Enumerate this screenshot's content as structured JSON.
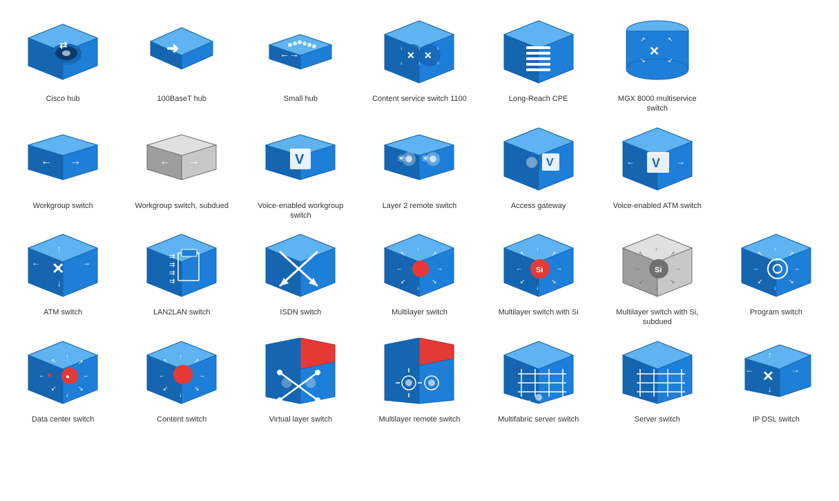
{
  "items": [
    {
      "id": "cisco-hub",
      "label": "Cisco hub",
      "type": "cisco-hub"
    },
    {
      "id": "100baset-hub",
      "label": "100BaseT hub",
      "type": "100baset-hub"
    },
    {
      "id": "small-hub",
      "label": "Small hub",
      "type": "small-hub"
    },
    {
      "id": "content-service-switch",
      "label": "Content service switch 1100",
      "type": "content-service-switch"
    },
    {
      "id": "long-reach-cpe",
      "label": "Long-Reach CPE",
      "type": "long-reach-cpe"
    },
    {
      "id": "mgx-8000",
      "label": "MGX 8000 multiservice switch",
      "type": "mgx-8000"
    },
    {
      "id": "empty1",
      "label": "",
      "type": "empty"
    },
    {
      "id": "workgroup-switch",
      "label": "Workgroup switch",
      "type": "workgroup-switch"
    },
    {
      "id": "workgroup-switch-subdued",
      "label": "Workgroup switch, subdued",
      "type": "workgroup-switch-subdued"
    },
    {
      "id": "voice-enabled-workgroup",
      "label": "Voice-enabled workgroup switch",
      "type": "voice-enabled-workgroup"
    },
    {
      "id": "layer2-remote-switch",
      "label": "Layer 2 remote switch",
      "type": "layer2-remote-switch"
    },
    {
      "id": "access-gateway",
      "label": "Access gateway",
      "type": "access-gateway"
    },
    {
      "id": "voice-enabled-atm",
      "label": "Voice-enabled ATM switch",
      "type": "voice-enabled-atm"
    },
    {
      "id": "empty2",
      "label": "",
      "type": "empty"
    },
    {
      "id": "atm-switch",
      "label": "ATM switch",
      "type": "atm-switch"
    },
    {
      "id": "lan2lan-switch",
      "label": "LAN2LAN switch",
      "type": "lan2lan-switch"
    },
    {
      "id": "isdn-switch",
      "label": "ISDN switch",
      "type": "isdn-switch"
    },
    {
      "id": "multilayer-switch",
      "label": "Multilayer switch",
      "type": "multilayer-switch"
    },
    {
      "id": "multilayer-switch-si",
      "label": "Multilayer switch with Si",
      "type": "multilayer-switch-si"
    },
    {
      "id": "multilayer-switch-si-subdued",
      "label": "Multilayer switch with Si, subdued",
      "type": "multilayer-switch-si-subdued"
    },
    {
      "id": "program-switch",
      "label": "Program switch",
      "type": "program-switch"
    },
    {
      "id": "data-center-switch",
      "label": "Data center switch",
      "type": "data-center-switch"
    },
    {
      "id": "content-switch",
      "label": "Content switch",
      "type": "content-switch"
    },
    {
      "id": "virtual-layer-switch",
      "label": "Virtual layer switch",
      "type": "virtual-layer-switch"
    },
    {
      "id": "multilayer-remote-switch",
      "label": "Multilayer remote switch",
      "type": "multilayer-remote-switch"
    },
    {
      "id": "multifabric-server-switch",
      "label": "Multifabric server switch",
      "type": "multifabric-server-switch"
    },
    {
      "id": "server-switch",
      "label": "Server switch",
      "type": "server-switch"
    },
    {
      "id": "ip-dsl-switch",
      "label": "IP DSL switch",
      "type": "ip-dsl-switch"
    }
  ]
}
